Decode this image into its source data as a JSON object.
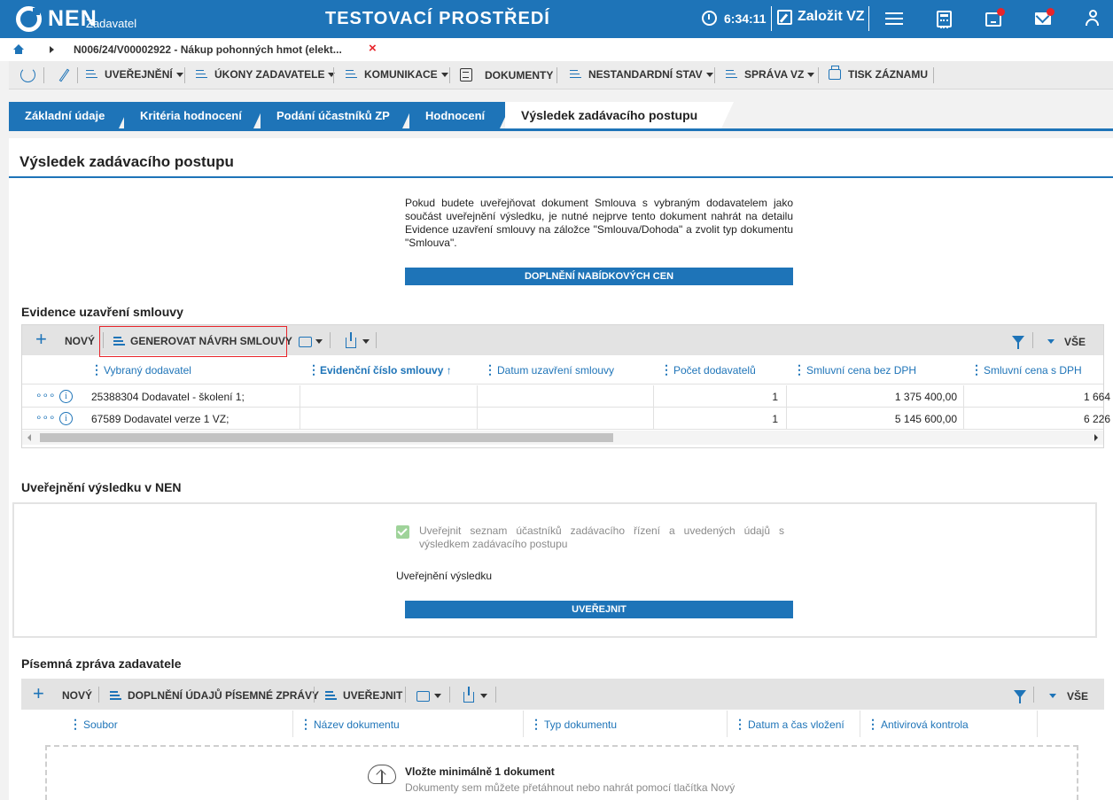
{
  "header": {
    "logo_text": "NEN",
    "logo_sub": "Zadavatel",
    "env_title": "TESTOVACÍ PROSTŘEDÍ",
    "time": "6:34:11",
    "create_label": "Založit VZ"
  },
  "breadcrumb": {
    "text": "N006/24/V00002922 - Nákup pohonných hmot (elekt...",
    "close": "×"
  },
  "actions": {
    "publish": "UVEŘEJNĚNÍ",
    "acts": "ÚKONY ZADAVATELE",
    "comm": "KOMUNIKACE",
    "docs": "DOKUMENTY",
    "nonstandard": "NESTANDARDNÍ STAV",
    "manage": "SPRÁVA VZ",
    "print": "TISK ZÁZNAMU"
  },
  "tabs": [
    {
      "label": "Základní údaje"
    },
    {
      "label": "Kritéria hodnocení"
    },
    {
      "label": "Podání účastníků ZP"
    },
    {
      "label": "Hodnocení"
    },
    {
      "label": "Výsledek zadávacího postupu"
    }
  ],
  "page": {
    "title": "Výsledek zadávacího postupu",
    "notice": "Pokud budete uveřejňovat dokument Smlouva s vybraným dodavatelem jako součást uveřejnění výsledku, je nutné nejprve tento dokument nahrát na detailu Evidence uzavření smlouvy na záložce \"Smlouva/Dohoda\" a zvolit typ dokumentu \"Smlouva\".",
    "prices_button": "DOPLNĚNÍ NABÍDKOVÝCH CEN"
  },
  "contracts": {
    "title": "Evidence uzavření smlouvy",
    "new": "NOVÝ",
    "generate": "GENEROVAT NÁVRH SMLOUVY",
    "all": "VŠE",
    "columns": [
      "Vybraný dodavatel",
      "Evidenční číslo smlouvy ↑",
      "Datum uzavření smlouvy",
      "Počet dodavatelů",
      "Smluvní cena bez DPH",
      "Smluvní cena s DPH"
    ],
    "rows": [
      {
        "supplier": "25388304 Dodavatel - školení 1;",
        "number": "",
        "date": "",
        "count": "1",
        "price": "1 375 400,00",
        "price_vat": "1 664"
      },
      {
        "supplier": "67589 Dodavatel verze 1 VZ;",
        "number": "",
        "date": "",
        "count": "1",
        "price": "5 145 600,00",
        "price_vat": "6 226"
      }
    ],
    "row_dots": "∘∘∘",
    "row_info": "i"
  },
  "publication": {
    "title": "Uveřejnění výsledku v NEN",
    "checkbox_label": "Uveřejnit seznam účastníků zadávacího řízení a uvedených údajů s výsledkem zadávacího postupu",
    "label": "Uveřejnění výsledku",
    "button": "UVEŘEJNIT"
  },
  "report": {
    "title": "Písemná zpráva zadavatele",
    "new": "NOVÝ",
    "fill": "DOPLNĚNÍ ÚDAJŮ PÍSEMNÉ ZPRÁVY",
    "publish": "UVEŘEJNIT",
    "all": "VŠE",
    "columns": [
      "Soubor",
      "Název dokumentu",
      "Typ dokumentu",
      "Datum a čas vložení",
      "Antivirová kontrola"
    ],
    "drop_title": "Vložte minimálně 1 dokument",
    "drop_sub": "Dokumenty sem můžete přetáhnout nebo nahrát pomocí tlačítka Nový"
  },
  "colors": {
    "brand": "#1e74b8",
    "alert": "#e8242a"
  }
}
